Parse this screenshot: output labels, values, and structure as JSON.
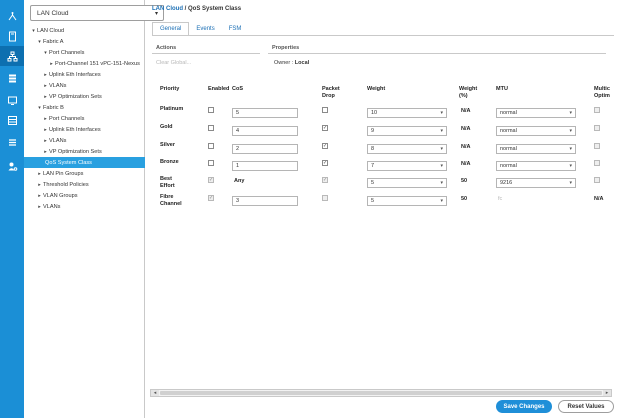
{
  "rail": {
    "icons": [
      "network-icon",
      "server-icon",
      "lan-icon",
      "storage-icon",
      "vm-icon",
      "chassis-icon",
      "list-icon",
      "admin-icon"
    ],
    "active_index": 2
  },
  "tree": {
    "filter_value": "LAN Cloud",
    "nodes": [
      {
        "label": "LAN Cloud",
        "toggle": "▾",
        "level": 0,
        "selected": false
      },
      {
        "label": "Fabric A",
        "toggle": "▾",
        "level": 1,
        "selected": false
      },
      {
        "label": "Port Channels",
        "toggle": "▾",
        "level": 2,
        "selected": false
      },
      {
        "label": "Port-Channel 151 vPC-151-Nexus",
        "toggle": "▸",
        "level": 3,
        "selected": false
      },
      {
        "label": "Uplink Eth Interfaces",
        "toggle": "▸",
        "level": 2,
        "selected": false
      },
      {
        "label": "VLANs",
        "toggle": "▸",
        "level": 2,
        "selected": false
      },
      {
        "label": "VP Optimization Sets",
        "toggle": "▸",
        "level": 2,
        "selected": false
      },
      {
        "label": "Fabric B",
        "toggle": "▾",
        "level": 1,
        "selected": false
      },
      {
        "label": "Port Channels",
        "toggle": "▸",
        "level": 2,
        "selected": false
      },
      {
        "label": "Uplink Eth Interfaces",
        "toggle": "▸",
        "level": 2,
        "selected": false
      },
      {
        "label": "VLANs",
        "toggle": "▸",
        "level": 2,
        "selected": false
      },
      {
        "label": "VP Optimization Sets",
        "toggle": "▸",
        "level": 2,
        "selected": false
      },
      {
        "label": "QoS System Class",
        "toggle": "",
        "level": 1,
        "selected": true
      },
      {
        "label": "LAN Pin Groups",
        "toggle": "▸",
        "level": 1,
        "selected": false
      },
      {
        "label": "Threshold Policies",
        "toggle": "▸",
        "level": 1,
        "selected": false
      },
      {
        "label": "VLAN Groups",
        "toggle": "▸",
        "level": 1,
        "selected": false
      },
      {
        "label": "VLANs",
        "toggle": "▸",
        "level": 1,
        "selected": false
      }
    ]
  },
  "breadcrumb": {
    "root": "LAN Cloud",
    "separator": "/",
    "current": "QoS System Class"
  },
  "tabs": [
    {
      "label": "General",
      "active": true
    },
    {
      "label": "Events",
      "active": false
    },
    {
      "label": "FSM",
      "active": false
    }
  ],
  "actions_title": "Actions",
  "clear_faults": "Clear Global...",
  "properties_title": "Properties",
  "owner_label": "Owner :",
  "owner_value": "Local",
  "columns": {
    "priority": "Priority",
    "enabled": "Enabled",
    "cos": "CoS",
    "packet_drop": [
      "Packet",
      "Drop"
    ],
    "weight": "Weight",
    "weight_pct": [
      "Weight",
      "(%)"
    ],
    "mtu": "MTU",
    "multicast": [
      "Multic",
      "Optim"
    ]
  },
  "rows": [
    {
      "priority": [
        "Platinum"
      ],
      "enabled": false,
      "enabled_disabled": false,
      "cos": "5",
      "cos_editable": true,
      "packet_drop": false,
      "packet_drop_disabled": false,
      "weight": "10",
      "weight_pct": "N/A",
      "mtu": "normal",
      "mtu_select": true,
      "multicast": false,
      "multicast_text": ""
    },
    {
      "priority": [
        "Gold"
      ],
      "enabled": false,
      "enabled_disabled": false,
      "cos": "4",
      "cos_editable": true,
      "packet_drop": true,
      "packet_drop_disabled": false,
      "weight": "9",
      "weight_pct": "N/A",
      "mtu": "normal",
      "mtu_select": true,
      "multicast": false,
      "multicast_text": ""
    },
    {
      "priority": [
        "Silver"
      ],
      "enabled": false,
      "enabled_disabled": false,
      "cos": "2",
      "cos_editable": true,
      "packet_drop": true,
      "packet_drop_disabled": false,
      "weight": "8",
      "weight_pct": "N/A",
      "mtu": "normal",
      "mtu_select": true,
      "multicast": false,
      "multicast_text": ""
    },
    {
      "priority": [
        "Bronze"
      ],
      "enabled": false,
      "enabled_disabled": false,
      "cos": "1",
      "cos_editable": true,
      "packet_drop": true,
      "packet_drop_disabled": false,
      "weight": "7",
      "weight_pct": "N/A",
      "mtu": "normal",
      "mtu_select": true,
      "multicast": false,
      "multicast_text": ""
    },
    {
      "priority": [
        "Best",
        "Effort"
      ],
      "enabled": true,
      "enabled_disabled": true,
      "cos": "Any",
      "cos_editable": false,
      "packet_drop": true,
      "packet_drop_disabled": true,
      "weight": "5",
      "weight_pct": "50",
      "mtu": "9216",
      "mtu_select": true,
      "multicast": false,
      "multicast_text": ""
    },
    {
      "priority": [
        "Fibre",
        "Channel"
      ],
      "enabled": true,
      "enabled_disabled": true,
      "cos": "3",
      "cos_editable": true,
      "packet_drop": false,
      "packet_drop_disabled": true,
      "weight": "5",
      "weight_pct": "50",
      "mtu": "fc",
      "mtu_select": false,
      "multicast": false,
      "multicast_text": "N/A"
    }
  ],
  "buttons": {
    "save": "Save Changes",
    "reset": "Reset Values"
  },
  "colors": {
    "rail": "#1b8fd6",
    "selected": "#29a0e0",
    "link": "#1b6fb5",
    "primary_button": "#1f8fd8"
  }
}
